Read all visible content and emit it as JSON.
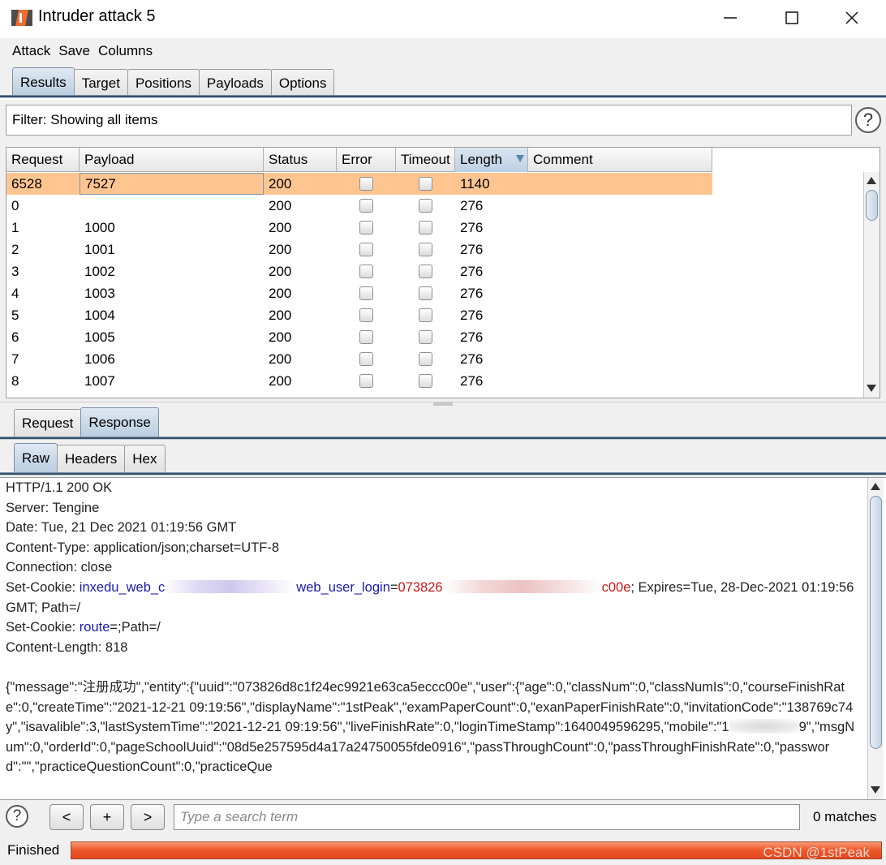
{
  "window": {
    "title": "Intruder attack 5",
    "controls": [
      "minimize",
      "maximize",
      "close"
    ]
  },
  "menu": [
    "Attack",
    "Save",
    "Columns"
  ],
  "main_tabs": [
    {
      "label": "Results",
      "active": true
    },
    {
      "label": "Target",
      "active": false
    },
    {
      "label": "Positions",
      "active": false
    },
    {
      "label": "Payloads",
      "active": false
    },
    {
      "label": "Options",
      "active": false
    }
  ],
  "filter": {
    "text": "Filter: Showing all items",
    "help": "?"
  },
  "results_table": {
    "columns": [
      "Request",
      "Payload",
      "Status",
      "Error",
      "Timeout",
      "Length",
      "Comment"
    ],
    "sorted_column": "Length",
    "rows": [
      {
        "request": "6528",
        "payload": "7527",
        "status": "200",
        "error": false,
        "timeout": false,
        "length": "1140",
        "comment": "",
        "selected": true
      },
      {
        "request": "0",
        "payload": "",
        "status": "200",
        "error": false,
        "timeout": false,
        "length": "276",
        "comment": ""
      },
      {
        "request": "1",
        "payload": "1000",
        "status": "200",
        "error": false,
        "timeout": false,
        "length": "276",
        "comment": ""
      },
      {
        "request": "2",
        "payload": "1001",
        "status": "200",
        "error": false,
        "timeout": false,
        "length": "276",
        "comment": ""
      },
      {
        "request": "3",
        "payload": "1002",
        "status": "200",
        "error": false,
        "timeout": false,
        "length": "276",
        "comment": ""
      },
      {
        "request": "4",
        "payload": "1003",
        "status": "200",
        "error": false,
        "timeout": false,
        "length": "276",
        "comment": ""
      },
      {
        "request": "5",
        "payload": "1004",
        "status": "200",
        "error": false,
        "timeout": false,
        "length": "276",
        "comment": ""
      },
      {
        "request": "6",
        "payload": "1005",
        "status": "200",
        "error": false,
        "timeout": false,
        "length": "276",
        "comment": ""
      },
      {
        "request": "7",
        "payload": "1006",
        "status": "200",
        "error": false,
        "timeout": false,
        "length": "276",
        "comment": ""
      },
      {
        "request": "8",
        "payload": "1007",
        "status": "200",
        "error": false,
        "timeout": false,
        "length": "276",
        "comment": ""
      }
    ]
  },
  "detail_tabs": [
    {
      "label": "Request",
      "active": false
    },
    {
      "label": "Response",
      "active": true
    }
  ],
  "view_tabs": [
    {
      "label": "Raw",
      "active": true
    },
    {
      "label": "Headers",
      "active": false
    },
    {
      "label": "Hex",
      "active": false
    }
  ],
  "response": {
    "status_line": "HTTP/1.1 200 OK",
    "server": "Server: Tengine",
    "date": "Date: Tue, 21 Dec 2021 01:19:56 GMT",
    "content_type": "Content-Type: application/json;charset=UTF-8",
    "connection": "Connection: close",
    "cookie1": {
      "prefix": "Set-Cookie: ",
      "name_start": "inxedu_web_c",
      "name_end": "web_user_login",
      "eq": "=",
      "value_start": "073826",
      "value_end": "c00e",
      "suffix": "; Expires=Tue, 28-Dec-2021 01:19:56 GMT; Path=/"
    },
    "cookie2": {
      "prefix": "Set-Cookie: ",
      "name": "route",
      "suffix": "=;Path=/"
    },
    "content_length": "Content-Length: 818",
    "body_part1": "{\"message\":\"注册成功\",\"entity\":{\"uuid\":\"073826d8c1f24ec9921e63ca5eccc00e\",\"user\":{\"age\":0,\"classNum\":0,\"classNumIs\":0,\"courseFinishRate\":0,\"createTime\":\"2021-12-21 09:19:56\",\"displayName\":\"1stPeak\",\"examPaperCount\":0,\"exanPaperFinishRate\":0,\"invitationCode\":\"138769c74y\",\"isavalible\":3,\"lastSystemTime\":\"2021-12-21 09:19:56\",\"liveFinishRate\":0,\"loginTimeStamp\":1640049596295,\"mobile\":\"1",
    "body_part2": "9\",\"msgNum\":0,\"orderId\":0,\"pageSchoolUuid\":\"08d5e257595d4a17a24750055fde0916\",\"passThroughCount\":0,\"passThroughFinishRate\":0,\"password\":\"\",\"practiceQuestionCount\":0,\"practiceQue"
  },
  "search": {
    "help": "?",
    "prev": "<",
    "add": "+",
    "next": ">",
    "placeholder": "Type a search term",
    "matches": "0 matches"
  },
  "status": {
    "label": "Finished",
    "progress": 1.0,
    "watermark": "CSDN @1stPeak"
  },
  "colors": {
    "selected_row": "#ffc591",
    "progress": "#ef5a2c",
    "tab_active": "#b9cde0",
    "cookie_name": "#1a1ab0",
    "cookie_value": "#c81818"
  }
}
